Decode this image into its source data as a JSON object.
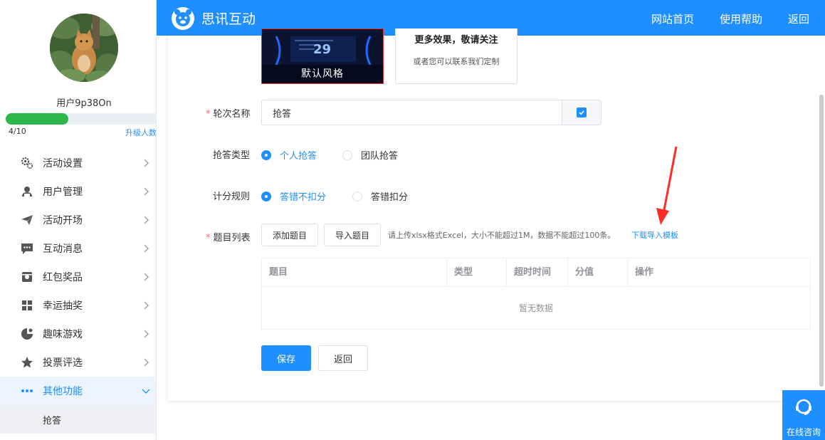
{
  "user": {
    "name": "用户9p38On",
    "progress_text": "4/10",
    "progress": 0.4,
    "upgrade_label": "升级人数"
  },
  "sidebar": {
    "items": [
      {
        "label": "活动设置",
        "icon": "gear-icon"
      },
      {
        "label": "用户管理",
        "icon": "user-icon"
      },
      {
        "label": "活动开场",
        "icon": "paper-plane-icon"
      },
      {
        "label": "互动消息",
        "icon": "chat-icon"
      },
      {
        "label": "红包奖品",
        "icon": "gift-icon"
      },
      {
        "label": "幸运抽奖",
        "icon": "lottery-icon"
      },
      {
        "label": "趣味游戏",
        "icon": "game-icon"
      },
      {
        "label": "投票评选",
        "icon": "star-icon"
      },
      {
        "label": "其他功能",
        "icon": "more-icon",
        "active": true
      }
    ],
    "subitem": "抢答"
  },
  "header": {
    "brand": "思讯互动",
    "nav": [
      "网站首页",
      "使用帮助",
      "返回"
    ]
  },
  "style_cards": {
    "default_label": "默认风格",
    "default_number": "29",
    "more_title": "更多效果，敬请关注",
    "more_sub": "或者您可以联系我们定制"
  },
  "form": {
    "round_name_label": "轮次名称",
    "round_name_value": "抢答",
    "answer_type_label": "抢答类型",
    "answer_type_options": [
      "个人抢答",
      "团队抢答"
    ],
    "answer_type_selected": 0,
    "score_rule_label": "计分规则",
    "score_rule_options": [
      "答错不扣分",
      "答错扣分"
    ],
    "score_rule_selected": 0,
    "question_list_label": "题目列表",
    "add_button": "添加题目",
    "import_button": "导入题目",
    "upload_hint": "请上传xlsx格式Excel，大小不能超过1M，数据不能超过100条。",
    "download_link": "下载导入模板"
  },
  "table": {
    "columns": [
      "题目",
      "类型",
      "超时时间",
      "分值",
      "操作"
    ],
    "empty_text": "暂无数据"
  },
  "actions": {
    "save": "保存",
    "back": "返回"
  },
  "consult": {
    "label": "在线咨询"
  },
  "colors": {
    "primary": "#1f8fff",
    "progress": "#2db84c",
    "required": "#f56c6c",
    "annotation": "#ff2a2a"
  }
}
